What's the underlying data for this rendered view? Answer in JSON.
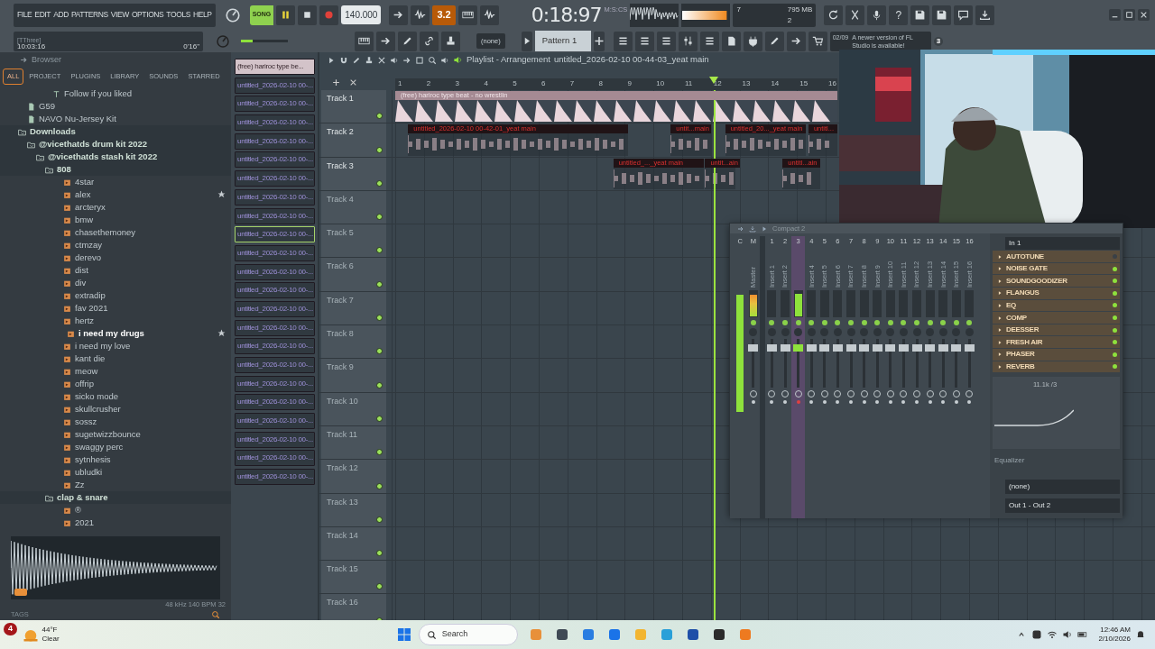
{
  "menu": [
    "FILE",
    "EDIT",
    "ADD",
    "PATTERNS",
    "VIEW",
    "OPTIONS",
    "TOOLS",
    "HELP"
  ],
  "transport": {
    "mode_label": "SONG",
    "song_mode": true,
    "playing": true,
    "tempo": "140.000",
    "countdown_label": "3.2",
    "countdown_on": true,
    "time": "0:18:97",
    "time_unit": "M:S:CS"
  },
  "hint": {
    "title": "[TThree]",
    "time": "10:03:16",
    "duration": "0'16\""
  },
  "master_pitch": {
    "level": 0.25
  },
  "output_meter": {
    "level": 0.95
  },
  "cpu": {
    "cpu": "7",
    "memory": "795 MB",
    "polyphony": "2"
  },
  "help_label": "?",
  "pattern": {
    "none_label": "(none)",
    "name": "Pattern 1"
  },
  "news": {
    "date": "02/09",
    "text": "A newer version of FL Studio is available!",
    "count": "3"
  },
  "browser": {
    "title": "Browser",
    "tabs": [
      {
        "label": "ALL",
        "selected": true
      },
      {
        "label": "PROJECT",
        "selected": false
      },
      {
        "label": "PLUGINS",
        "selected": false
      },
      {
        "label": "LIBRARY",
        "selected": false
      },
      {
        "label": "SOUNDS",
        "selected": false
      },
      {
        "label": "STARRED",
        "selected": false
      }
    ],
    "tree": [
      {
        "label": "Follow if you liked",
        "kind": "text"
      },
      {
        "label": "G59",
        "kind": "kit"
      },
      {
        "label": "NAVO Nu-Jersey Kit",
        "kind": "kit"
      },
      {
        "label": "Downloads",
        "kind": "folder",
        "expanded": true,
        "children": [
          {
            "label": "@vicethatds drum kit 2022",
            "kind": "folder",
            "expanded": true,
            "children": [
              {
                "label": "@vicethatds stash kit 2022",
                "kind": "folder",
                "expanded": true,
                "children": [
                  {
                    "label": "808",
                    "kind": "folder",
                    "expanded": true,
                    "children": [
                      {
                        "label": "4star",
                        "kind": "file",
                        "starred": false,
                        "selected": false
                      },
                      {
                        "label": "alex",
                        "kind": "file",
                        "starred": true,
                        "selected": false
                      },
                      {
                        "label": "arcteryx",
                        "kind": "file",
                        "starred": false,
                        "selected": false
                      },
                      {
                        "label": "bmw",
                        "kind": "file",
                        "starred": false,
                        "selected": false
                      },
                      {
                        "label": "chasethemoney",
                        "kind": "file",
                        "starred": false,
                        "selected": false
                      },
                      {
                        "label": "ctmzay",
                        "kind": "file",
                        "starred": false,
                        "selected": false
                      },
                      {
                        "label": "derevo",
                        "kind": "file",
                        "starred": false,
                        "selected": false
                      },
                      {
                        "label": "dist",
                        "kind": "file",
                        "starred": false,
                        "selected": false
                      },
                      {
                        "label": "div",
                        "kind": "file",
                        "starred": false,
                        "selected": false
                      },
                      {
                        "label": "extradip",
                        "kind": "file",
                        "starred": false,
                        "selected": false
                      },
                      {
                        "label": "fav 2021",
                        "kind": "file",
                        "starred": false,
                        "selected": false
                      },
                      {
                        "label": "hertz",
                        "kind": "file",
                        "starred": false,
                        "selected": false
                      },
                      {
                        "label": "i need my drugs",
                        "kind": "file",
                        "starred": true,
                        "selected": true
                      },
                      {
                        "label": "i need my love",
                        "kind": "file",
                        "starred": false,
                        "selected": false
                      },
                      {
                        "label": "kant die",
                        "kind": "file",
                        "starred": false,
                        "selected": false
                      },
                      {
                        "label": "meow",
                        "kind": "file",
                        "starred": false,
                        "selected": false
                      },
                      {
                        "label": "offrip",
                        "kind": "file",
                        "starred": false,
                        "selected": false
                      },
                      {
                        "label": "sicko mode",
                        "kind": "file",
                        "starred": false,
                        "selected": false
                      },
                      {
                        "label": "skullcrusher",
                        "kind": "file",
                        "starred": false,
                        "selected": false
                      },
                      {
                        "label": "sossz",
                        "kind": "file",
                        "starred": false,
                        "selected": false
                      },
                      {
                        "label": "sugetwizzbounce",
                        "kind": "file",
                        "starred": false,
                        "selected": false
                      },
                      {
                        "label": "swaggy perc",
                        "kind": "file",
                        "starred": false,
                        "selected": false
                      },
                      {
                        "label": "sytnhesis",
                        "kind": "file",
                        "starred": false,
                        "selected": false
                      },
                      {
                        "label": "ubludki",
                        "kind": "file",
                        "starred": false,
                        "selected": false
                      },
                      {
                        "label": "Zz",
                        "kind": "file",
                        "starred": false,
                        "selected": false
                      }
                    ]
                  },
                  {
                    "label": "clap & snare",
                    "kind": "folder",
                    "expanded": true,
                    "children": [
                      {
                        "label": "®",
                        "kind": "file",
                        "starred": false,
                        "selected": false
                      },
                      {
                        "label": "2021",
                        "kind": "file",
                        "starred": false,
                        "selected": false
                      }
                    ]
                  }
                ]
              }
            ]
          }
        ]
      }
    ],
    "sample_info": "48 kHz 140 BPM 32",
    "tags_label": "TAGS"
  },
  "picker": [
    {
      "label": "(free) hariroc type be...",
      "kind": "audio",
      "selected": false
    },
    {
      "label": "untitled_2026-02-10 00-...",
      "kind": "pattern",
      "selected": false
    },
    {
      "label": "untitled_2026-02-10 00-...",
      "kind": "pattern",
      "selected": false
    },
    {
      "label": "untitled_2026-02-10 00-...",
      "kind": "pattern",
      "selected": false
    },
    {
      "label": "untitled_2026-02-10 00-...",
      "kind": "pattern",
      "selected": false
    },
    {
      "label": "untitled_2026-02-10 00-...",
      "kind": "pattern",
      "selected": false
    },
    {
      "label": "untitled_2026-02-10 00-...",
      "kind": "pattern",
      "selected": false
    },
    {
      "label": "untitled_2026-02-10 00-...",
      "kind": "pattern",
      "selected": false
    },
    {
      "label": "untitled_2026-02-10 00-...",
      "kind": "pattern",
      "selected": false
    },
    {
      "label": "untitled_2026-02-10 00-...",
      "kind": "pattern",
      "selected": true
    },
    {
      "label": "untitled_2026-02-10 00-...",
      "kind": "pattern",
      "selected": false
    },
    {
      "label": "untitled_2026-02-10 00-...",
      "kind": "pattern",
      "selected": false
    },
    {
      "label": "untitled_2026-02-10 00-...",
      "kind": "pattern",
      "selected": false
    },
    {
      "label": "untitled_2026-02-10 00-...",
      "kind": "pattern",
      "selected": false
    },
    {
      "label": "untitled_2026-02-10 00-...",
      "kind": "pattern",
      "selected": false
    },
    {
      "label": "untitled_2026-02-10 00-...",
      "kind": "pattern",
      "selected": false
    },
    {
      "label": "untitled_2026-02-10 00-...",
      "kind": "pattern",
      "selected": false
    },
    {
      "label": "untitled_2026-02-10 00-...",
      "kind": "pattern",
      "selected": false
    },
    {
      "label": "untitled_2026-02-10 00-...",
      "kind": "pattern",
      "selected": false
    },
    {
      "label": "untitled_2026-02-10 00-...",
      "kind": "pattern",
      "selected": false
    },
    {
      "label": "untitled_2026-02-10 00-...",
      "kind": "pattern",
      "selected": false
    },
    {
      "label": "untitled_2026-02-10 00-...",
      "kind": "pattern",
      "selected": false
    },
    {
      "label": "untitled_2026-02-10 00-...",
      "kind": "pattern",
      "selected": false
    }
  ],
  "playlist": {
    "title": "Playlist - Arrangement",
    "breadcrumb": "untitled_2026-02-10 00-44-03_yeat main",
    "ruler": [
      "1",
      "2",
      "3",
      "4",
      "5",
      "6",
      "7",
      "8",
      "9",
      "10",
      "11",
      "12",
      "13",
      "14",
      "15",
      "16"
    ],
    "tracks": [
      {
        "name": "Track 1",
        "clips": [
          {
            "label": "(free) hariroc type beat - no wrestlin",
            "kind": "audio"
          }
        ]
      },
      {
        "name": "Track 2",
        "clips": [
          {
            "label": "untitled_2026-02-10 00-42-01_yeat main",
            "kind": "pattern"
          },
          {
            "label": "untit...main",
            "kind": "pattern"
          },
          {
            "label": "untitled_20..._yeat main",
            "kind": "pattern"
          },
          {
            "label": "untitl...",
            "kind": "pattern"
          }
        ]
      },
      {
        "name": "Track 3",
        "clips": [
          {
            "label": "untitled_..._yeat main",
            "kind": "pattern"
          },
          {
            "label": "untit...ain",
            "kind": "pattern"
          },
          {
            "label": "untitl...ain",
            "kind": "pattern"
          }
        ]
      },
      {
        "name": "Track 4"
      },
      {
        "name": "Track 5"
      },
      {
        "name": "Track 6"
      },
      {
        "name": "Track 7"
      },
      {
        "name": "Track 8"
      },
      {
        "name": "Track 9"
      },
      {
        "name": "Track 10"
      },
      {
        "name": "Track 11"
      },
      {
        "name": "Track 12"
      },
      {
        "name": "Track 13"
      },
      {
        "name": "Track 14"
      },
      {
        "name": "Track 15"
      },
      {
        "name": "Track 16"
      }
    ]
  },
  "mixer": {
    "title": "Compact 2",
    "master": {
      "number": "M",
      "name": "Master",
      "level": 0.85
    },
    "current_label": "C",
    "channels": [
      {
        "number": "1",
        "name": "Insert 1",
        "selected": false
      },
      {
        "number": "2",
        "name": "Insert 2",
        "selected": false
      },
      {
        "number": "3",
        "level": 0.9,
        "selected": true
      },
      {
        "number": "4",
        "name": "Insert 4",
        "selected": false
      },
      {
        "number": "5",
        "name": "Insert 5",
        "selected": false
      },
      {
        "number": "6",
        "name": "Insert 6",
        "selected": false
      },
      {
        "number": "7",
        "name": "Insert 7",
        "selected": false
      },
      {
        "number": "8",
        "name": "Insert 8",
        "selected": false
      },
      {
        "number": "9",
        "name": "Insert 9",
        "selected": false
      },
      {
        "number": "10",
        "name": "Insert 10",
        "selected": false
      },
      {
        "number": "11",
        "name": "Insert 11",
        "selected": false
      },
      {
        "number": "12",
        "name": "Insert 12",
        "selected": false
      },
      {
        "number": "13",
        "name": "Insert 13",
        "selected": false
      },
      {
        "number": "14",
        "name": "Insert 14",
        "selected": false
      },
      {
        "number": "15",
        "name": "Insert 15",
        "selected": false
      },
      {
        "number": "16",
        "name": "Insert 16",
        "selected": false
      }
    ],
    "input": "In 1",
    "effects": [
      {
        "name": "AUTOTUNE",
        "on": false
      },
      {
        "name": "NOISE GATE",
        "on": true
      },
      {
        "name": "SOUNDGOODIZER",
        "on": true
      },
      {
        "name": "FLANGUS",
        "on": true
      },
      {
        "name": "EQ",
        "on": true
      },
      {
        "name": "COMP",
        "on": true
      },
      {
        "name": "DEESSER",
        "on": true
      },
      {
        "name": "FRESH AIR",
        "on": true
      },
      {
        "name": "PHASER",
        "on": true
      },
      {
        "name": "REVERB",
        "on": true
      }
    ],
    "eq_readout": "11.1k /3",
    "eq_label": "Equalizer",
    "sidechain": "(none)",
    "output": "Out 1 - Out 2"
  },
  "taskbar": {
    "weather_badge": "4",
    "temperature": "44°F",
    "condition": "Clear",
    "search": "Search",
    "time": "12:46 AM",
    "date": "2/10/2026"
  }
}
